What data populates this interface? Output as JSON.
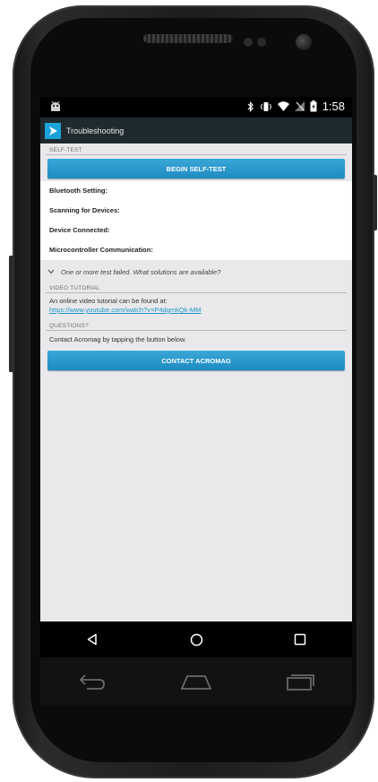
{
  "status_bar": {
    "time": "1:58"
  },
  "action_bar": {
    "title": "Troubleshooting"
  },
  "self_test": {
    "header": "SELF-TEST",
    "button_label": "BEGIN SELF-TEST",
    "items": [
      {
        "label": "Bluetooth Setting:"
      },
      {
        "label": "Scanning for Devices:"
      },
      {
        "label": "Device Connected:"
      },
      {
        "label": "Microcontroller Communication:"
      }
    ],
    "faq": "One or more test failed. What solutions are available?"
  },
  "video_tutorial": {
    "header": "VIDEO TUTORIAL",
    "text": "An online video tutorial can be found at:",
    "link": "https://www.youtube.com/watch?v=P4dgmkQk-MM"
  },
  "questions": {
    "header": "QUESTIONS?",
    "text": "Contact Acromag by tapping the button below.",
    "button_label": "CONTACT ACROMAG"
  },
  "colors": {
    "accent": "#1e8bc1",
    "action_bar": "#1f2a2e",
    "link": "#2196c9",
    "background": "#e9e9eb"
  }
}
